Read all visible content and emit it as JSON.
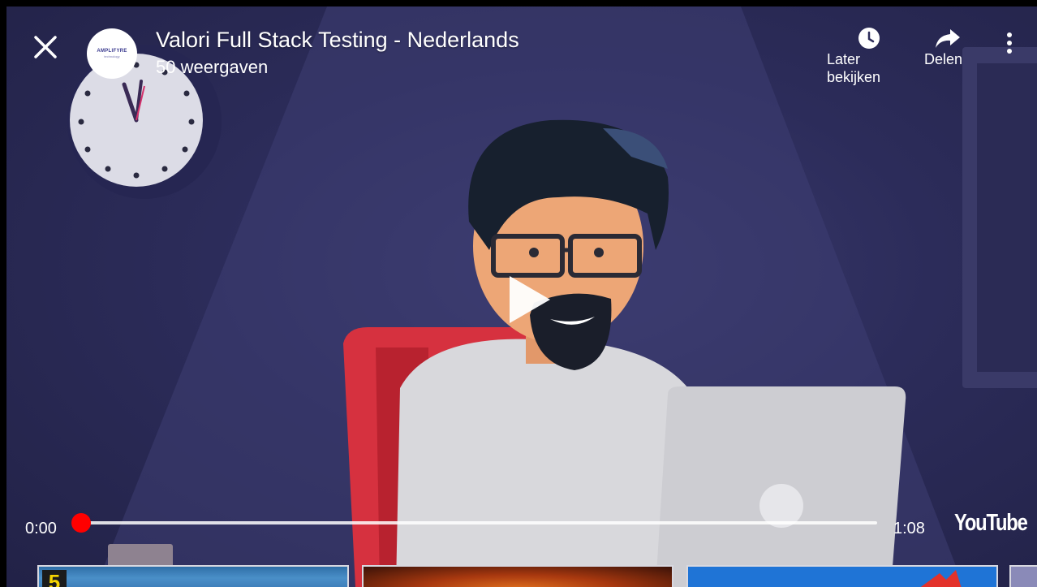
{
  "player": {
    "title": "Valori Full Stack Testing - Nederlands",
    "views": "50 weergaven",
    "channel_avatar_text": "AMPLIFYRE",
    "channel_avatar_sub": "technology",
    "progress": 0,
    "accent_color": "#ff0000"
  },
  "actions": {
    "later_line1": "Later",
    "later_line2": "bekijken",
    "share_label": "Delen"
  },
  "controls": {
    "time_current": "0:00",
    "time_total": "1:08",
    "logo": "YouTube"
  },
  "related": {
    "thumb1_badge": "5"
  },
  "icons": [
    "close-icon",
    "clock-icon",
    "share-icon",
    "more-vert-icon",
    "play-icon"
  ]
}
